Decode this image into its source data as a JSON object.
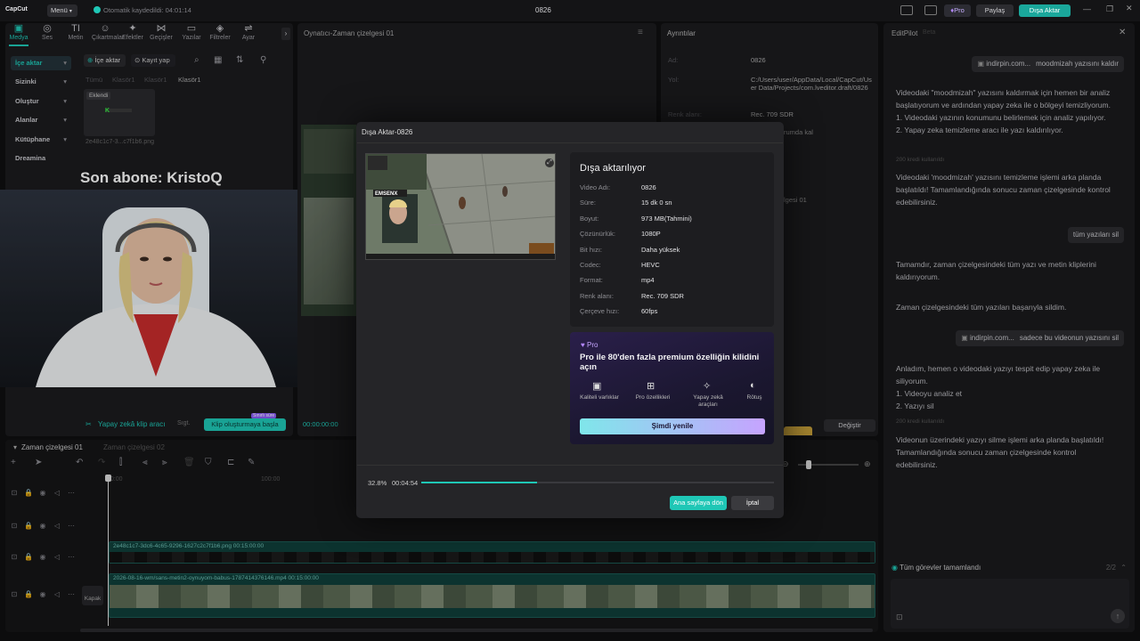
{
  "app": {
    "logo": "CapCut",
    "menu": "Menü",
    "autosave": "Otomatik kaydedildi: 04:01:14",
    "project": "0826",
    "pro_badge": "Pro",
    "share": "Paylaş",
    "export": "Dışa Aktar"
  },
  "toolbar": [
    {
      "label": "Medya",
      "icon": "▣"
    },
    {
      "label": "Ses",
      "icon": "◎"
    },
    {
      "label": "Metin",
      "icon": "TI"
    },
    {
      "label": "Çıkartmalar",
      "icon": "☺"
    },
    {
      "label": "Efektler",
      "icon": "✦"
    },
    {
      "label": "Geçişler",
      "icon": "⋈"
    },
    {
      "label": "Yazılar",
      "icon": "▭"
    },
    {
      "label": "Filtreler",
      "icon": "◈"
    },
    {
      "label": "Ayar",
      "icon": "⇌"
    }
  ],
  "sidebar": [
    {
      "label": "İçe aktar"
    },
    {
      "label": "Sizinki"
    },
    {
      "label": "Oluştur"
    },
    {
      "label": "Alanlar"
    },
    {
      "label": "Kütüphane"
    },
    {
      "label": "Dreamina"
    }
  ],
  "media": {
    "import_btn": "İçe aktar",
    "record_btn": "Kayıt yap",
    "filters": [
      "Tümü",
      "Klasör1",
      "Klasör1",
      "Klasör1"
    ],
    "thumb_tag": "Eklendi",
    "thumb_name": "2e48c1c7-3...c7f1b6.png",
    "ai_clip": "Yapay zekâ klip aracı",
    "ai_settings": "Sıgt.",
    "ai_start": "Klip oluşturmaya başla",
    "ai_badge": "Sınırlı süre"
  },
  "overlay": {
    "subscriber": "Son abone: KristoQ"
  },
  "player": {
    "title": "Oynatıcı-Zaman çizelgesi 01",
    "time": "00:00:00:00"
  },
  "details": {
    "title": "Ayrıntılar",
    "name_label": "Ad:",
    "name_value": "0826",
    "path_label": "Yol:",
    "path_value": "C:/Users/user/AppData/Local/CapCut/User Data/Projects/com.lveditor.draft/0826",
    "color_label": "Renk alanı:",
    "color_value": "Rec. 709 SDR",
    "partial1": "rumda kal",
    "partial2": "lgesi 01",
    "change_btn": "Değiştir"
  },
  "modal": {
    "title": "Dışa Aktar-0826",
    "status": "Dışa aktarılıyor",
    "info": [
      {
        "k": "Video Adı:",
        "v": "0826"
      },
      {
        "k": "Süre:",
        "v": "15 dk 0 sn"
      },
      {
        "k": "Boyut:",
        "v": "973 MB(Tahmini)"
      },
      {
        "k": "Çözünürlük:",
        "v": "1080P"
      },
      {
        "k": "Bit hızı:",
        "v": "Daha yüksek"
      },
      {
        "k": "Codec:",
        "v": "HEVC"
      },
      {
        "k": "Format:",
        "v": "mp4"
      },
      {
        "k": "Renk alanı:",
        "v": "Rec. 709 SDR"
      },
      {
        "k": "Çerçeve hızı:",
        "v": "60fps"
      }
    ],
    "pro_label": "Pro",
    "pro_text": "Pro ile 80'den fazla premium özelliğin kilidini açın",
    "features": [
      "Kaliteli varlıklar",
      "Pro özellikleri",
      "Yapay zekâ araçları",
      "Rötuş"
    ],
    "renew": "Şimdi yenile",
    "progress_pct": "32.8%",
    "progress_time": "00:04:54",
    "progress_value": 0.328,
    "home_btn": "Ana sayfaya dön",
    "cancel_btn": "İptal"
  },
  "timeline": {
    "tab1": "Zaman çizelgesi 01",
    "tab2": "Zaman çizelgesi 02",
    "ruler": [
      "00:00",
      "100:00"
    ],
    "clip1": "2e48c1c7-3dc6-4c65-9296-1627c2c7f1b6.png   00:15:00:00",
    "clip2": "2026-08-16-wm/sans-metin2-oynuyom-babus-1787414376146.mp4   00:15:00:00",
    "cover": "Kapak"
  },
  "editpilot": {
    "title": "EditPilot",
    "tag": "Beta",
    "msgs": [
      {
        "type": "user",
        "link": "indirpin.com...",
        "text": "moodmizah yazısını kaldır"
      },
      {
        "type": "bot",
        "text": "Videodaki \"moodmizah\" yazısını kaldırmak için hemen bir analiz başlatıyorum ve ardından yapay zeka ile o bölgeyi temizliyorum.\n1. Videodaki yazının konumunu belirlemek için analiz yapılıyor.\n2. Yapay zeka temizleme aracı ile yazı kaldırılıyor."
      },
      {
        "type": "note",
        "text": "200 kredi kullanıldı"
      },
      {
        "type": "bot",
        "text": "Videodaki 'moodmizah' yazısını temizleme işlemi arka planda başlatıldı! Tamamlandığında sonucu zaman çizelgesinde kontrol edebilirsiniz."
      },
      {
        "type": "user",
        "text": "tüm yazıları sil"
      },
      {
        "type": "bot",
        "text": "Tamamdır, zaman çizelgesindeki tüm yazı ve metin kliplerini kaldırıyorum."
      },
      {
        "type": "bot",
        "text": "Zaman çizelgesindeki tüm yazıları başarıyla sildim."
      },
      {
        "type": "user",
        "link": "indirpin.com...",
        "text": "sadece bu videonun yazısını sil"
      },
      {
        "type": "bot",
        "text": "Anladım, hemen o videodaki yazıyı tespit edip yapay zeka ile siliyorum.\n1. Videoyu analiz et\n2. Yazıyı sil"
      },
      {
        "type": "note",
        "text": "200 kredi kullanıldı"
      },
      {
        "type": "bot",
        "text": "Videonun üzerindeki yazıyı silme işlemi arka planda başlatıldı! Tamamlandığında sonucu zaman çizelgesinde kontrol edebilirsiniz."
      }
    ],
    "tasks": "Tüm görevler tamamlandı",
    "tasks_count": "2/2"
  },
  "colors": {
    "accent": "#1fc7b6",
    "pro": "#b487ff",
    "bg": "#0f0f10"
  }
}
